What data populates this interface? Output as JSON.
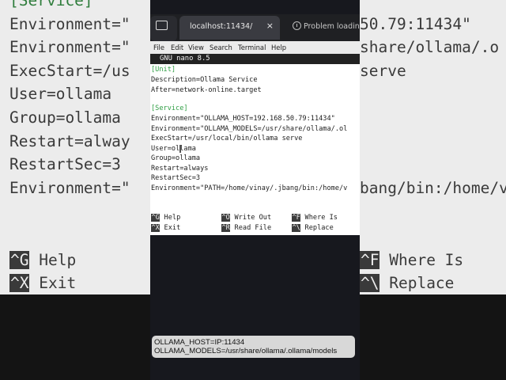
{
  "background": {
    "header_partial": "[Service]",
    "lines": [
      "Environment=\"",
      "Environment=\"",
      "ExecStart=/us",
      "User=ollama",
      "Group=ollama",
      "Restart=alway",
      "RestartSec=3",
      "Environment=\""
    ],
    "right_fragments": [
      "50.79:11434\"",
      "share/ollama/.o",
      "serve",
      "",
      "",
      "",
      "",
      "bang/bin:/home/v"
    ],
    "shortcuts_left": [
      {
        "key": "^G",
        "label": "Help"
      },
      {
        "key": "^X",
        "label": "Exit"
      }
    ],
    "shortcuts_right": [
      {
        "key": "^F",
        "label": "Where Is"
      },
      {
        "key": "^\\",
        "label": "Replace"
      }
    ]
  },
  "browser": {
    "active_tab_title": "localhost:11434/",
    "close_glyph": "×",
    "second_tab_title": "Problem loading p"
  },
  "terminal": {
    "menu": [
      "File",
      "Edit",
      "View",
      "Search",
      "Terminal",
      "Help"
    ],
    "nano_title": "GNU nano 8.5",
    "lines": [
      "[Unit]",
      "Description=Ollama Service",
      "After=network-online.target",
      "",
      "[Service]",
      "Environment=\"OLLAMA_HOST=192.168.50.79:11434\"",
      "Environment=\"OLLAMA_MODELS=/usr/share/ollama/.ol",
      "ExecStart=/usr/local/bin/ollama serve",
      "User=ollama",
      "Group=ollama",
      "Restart=always",
      "RestartSec=3",
      "Environment=\"PATH=/home/vinay/.jbang/bin:/home/v"
    ],
    "shortcuts": [
      {
        "key": "^G",
        "label": "Help"
      },
      {
        "key": "^O",
        "label": "Write Out"
      },
      {
        "key": "^F",
        "label": "Where Is"
      },
      {
        "key": "^X",
        "label": "Exit"
      },
      {
        "key": "^R",
        "label": "Read File"
      },
      {
        "key": "^\\",
        "label": "Replace"
      }
    ]
  },
  "caption": {
    "line1": "OLLAMA_HOST=IP:11434",
    "line2": "OLLAMA_MODELS=/usr/share/ollama/.ollama/models"
  },
  "colors": {
    "section_header": "#2f9e44",
    "nano_header_bg": "#222222",
    "terminal_bg": "#ffffff",
    "page_bg": "#17181e"
  }
}
